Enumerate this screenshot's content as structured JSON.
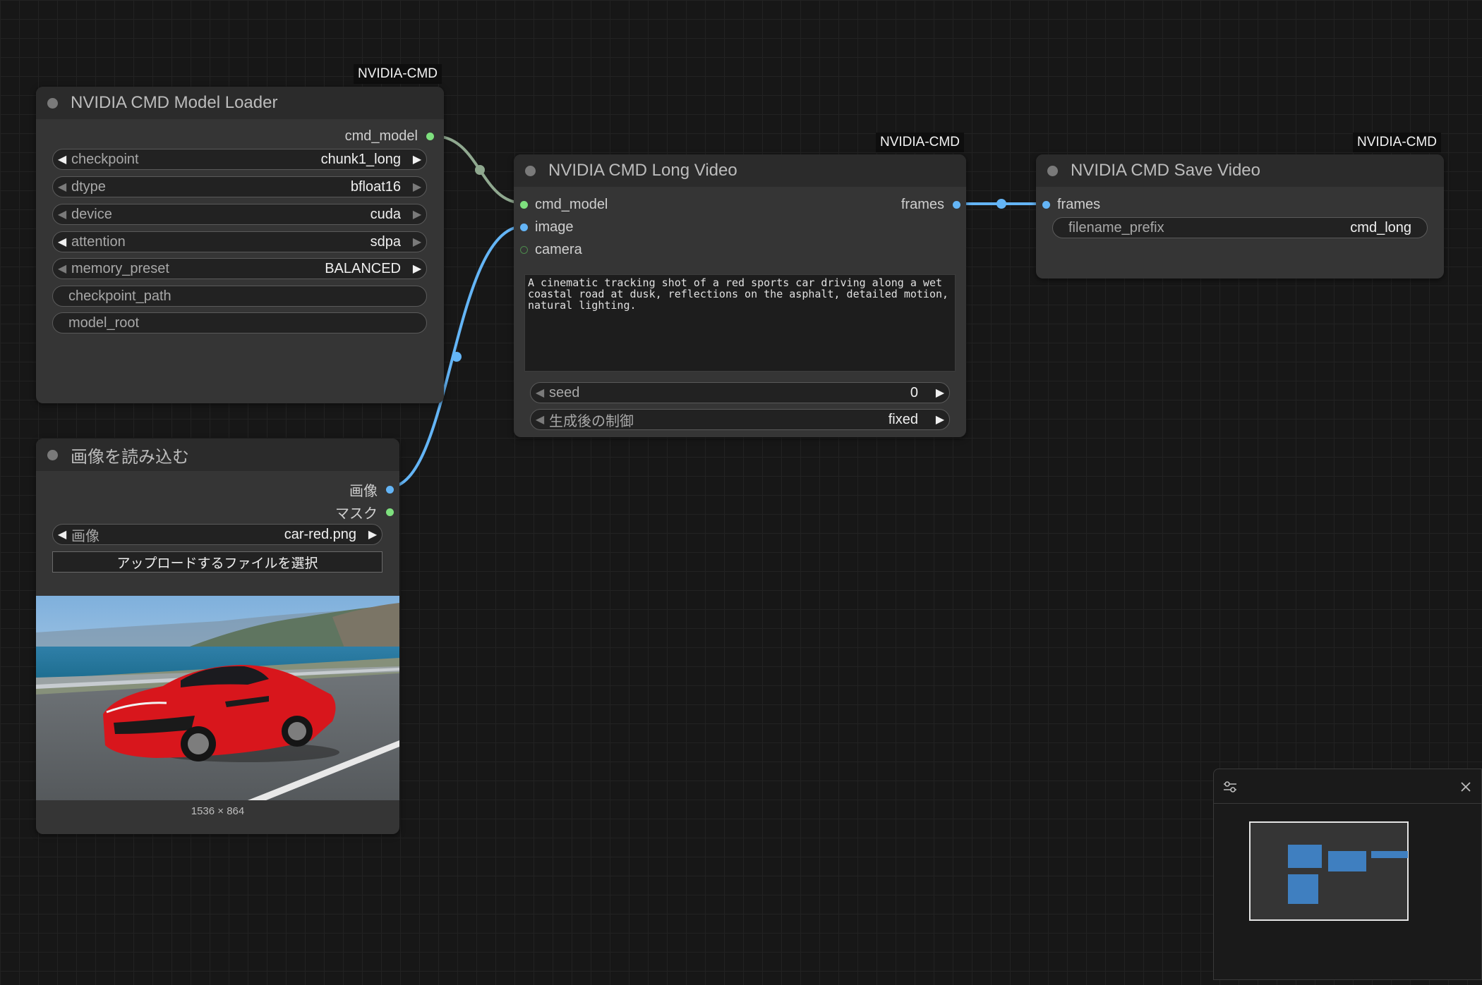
{
  "badges": {
    "loader": "NVIDIA-CMD",
    "long_video": "NVIDIA-CMD",
    "save_video": "NVIDIA-CMD"
  },
  "loader": {
    "title": "NVIDIA CMD Model Loader",
    "output": "cmd_model",
    "widgets": [
      {
        "name": "checkpoint",
        "value": "chunk1_long"
      },
      {
        "name": "dtype",
        "value": "bfloat16"
      },
      {
        "name": "device",
        "value": "cuda"
      },
      {
        "name": "attention",
        "value": "sdpa"
      },
      {
        "name": "memory_preset",
        "value": "BALANCED"
      },
      {
        "name": "checkpoint_path",
        "value": ""
      },
      {
        "name": "model_root",
        "value": ""
      }
    ]
  },
  "long_video": {
    "title": "NVIDIA CMD Long Video",
    "inputs": [
      "cmd_model",
      "image",
      "camera"
    ],
    "output": "frames",
    "prompt": "A cinematic tracking shot of a red sports car driving along a wet coastal road at dusk, reflections on the asphalt, detailed motion, natural lighting.",
    "widgets": [
      {
        "name": "seed",
        "value": "0"
      },
      {
        "name": "生成後の制御",
        "value": "fixed"
      }
    ]
  },
  "save_video": {
    "title": "NVIDIA CMD Save Video",
    "input": "frames",
    "widgets": [
      {
        "name": "filename_prefix",
        "value": "cmd_long"
      }
    ]
  },
  "load_image": {
    "title": "画像を読み込む",
    "outputs": [
      "画像",
      "マスク"
    ],
    "widget": {
      "name": "画像",
      "value": "car-red.png"
    },
    "upload_label": "アップロードするファイルを選択",
    "image_size": "1536 × 864"
  },
  "colors": {
    "model_link": "#8fa88f",
    "image_link": "#64b5f6",
    "model_slot": "#7ee07e",
    "image_slot": "#64b5f6",
    "node_body": "#353535",
    "node_header": "#2b2b2b",
    "car": "#d8161c"
  },
  "icons": {
    "minimap_settings": "sliders-icon",
    "minimap_close": "close-icon"
  }
}
